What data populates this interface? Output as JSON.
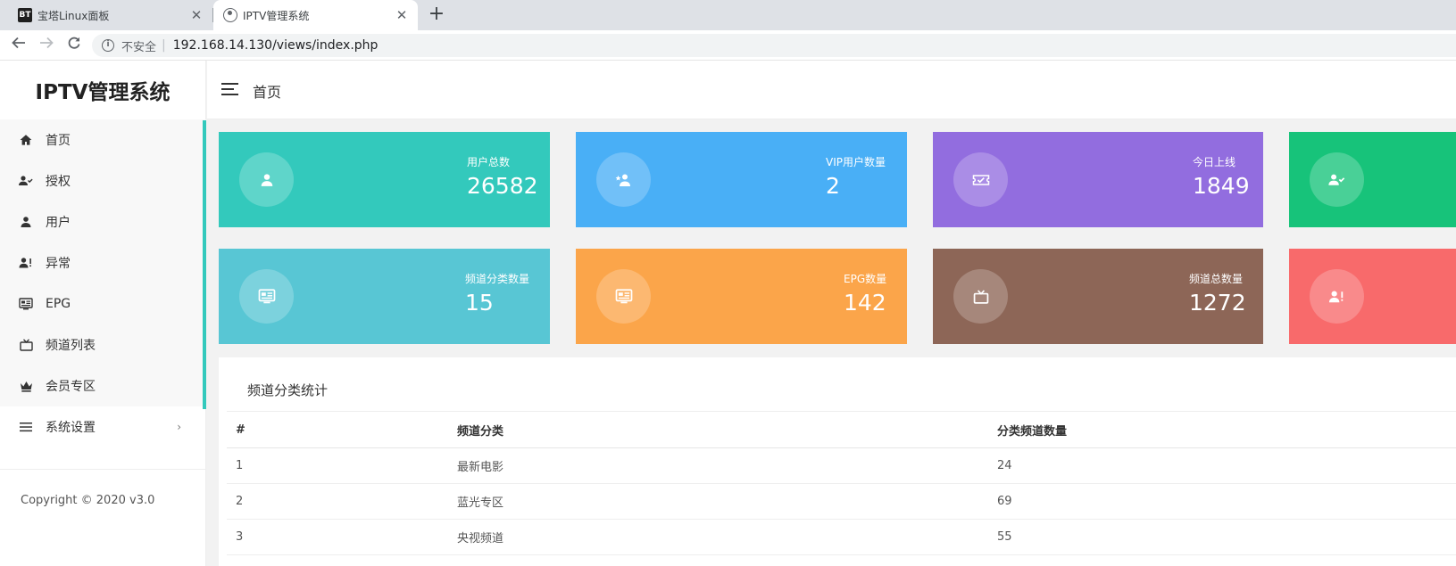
{
  "browser": {
    "tabs": [
      {
        "title": "宝塔Linux面板",
        "favicon": "BT"
      },
      {
        "title": "IPTV管理系统",
        "favicon": "user-circle-icon"
      }
    ],
    "security_label": "不安全",
    "url": "192.168.14.130/views/index.php"
  },
  "sidebar": {
    "logo": "IPTV管理系统",
    "items": [
      {
        "label": "首页",
        "icon": "home-icon"
      },
      {
        "label": "授权",
        "icon": "user-check-icon"
      },
      {
        "label": "用户",
        "icon": "user-icon"
      },
      {
        "label": "异常",
        "icon": "user-alert-icon"
      },
      {
        "label": "EPG",
        "icon": "epg-icon"
      },
      {
        "label": "频道列表",
        "icon": "tv-icon"
      },
      {
        "label": "会员专区",
        "icon": "crown-icon"
      },
      {
        "label": "系统设置",
        "icon": "menu-icon"
      }
    ],
    "settings_arrow": "›",
    "copyright": "Copyright © 2020 v3.0"
  },
  "header": {
    "title": "首页"
  },
  "cards": [
    {
      "label": "用户总数",
      "value": "26582",
      "color": "#33c9bc",
      "icon": "user-icon"
    },
    {
      "label": "VIP用户数量",
      "value": "2",
      "color": "#49aff6",
      "icon": "user-star-icon"
    },
    {
      "label": "今日上线",
      "value": "1849",
      "color": "#926ddf",
      "icon": "ticket-check-icon"
    },
    {
      "label": "",
      "value": "",
      "color": "#17c37a",
      "icon": "user-check-icon"
    },
    {
      "label": "频道分类数量",
      "value": "15",
      "color": "#58c6d4",
      "icon": "epg-icon"
    },
    {
      "label": "EPG数量",
      "value": "142",
      "color": "#fba54a",
      "icon": "epg-icon"
    },
    {
      "label": "频道总数量",
      "value": "1272",
      "color": "#8d6657",
      "icon": "tv-icon"
    },
    {
      "label": "",
      "value": "",
      "color": "#f86a6b",
      "icon": "user-alert-icon"
    }
  ],
  "table": {
    "title": "频道分类统计",
    "headers": [
      "#",
      "频道分类",
      "分类频道数量"
    ],
    "rows": [
      [
        "1",
        "最新电影",
        "24"
      ],
      [
        "2",
        "蓝光专区",
        "69"
      ],
      [
        "3",
        "央视频道",
        "55"
      ]
    ]
  }
}
